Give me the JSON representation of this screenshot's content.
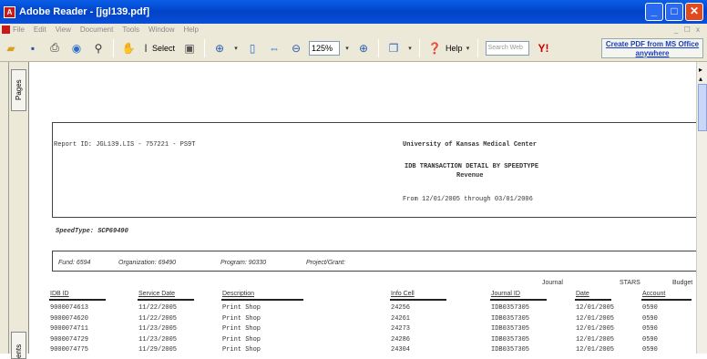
{
  "window": {
    "title": "Adobe Reader - [jgl139.pdf]",
    "minimize": "_",
    "maximize": "□",
    "close": "✕"
  },
  "menu": {
    "items": [
      "File",
      "Edit",
      "View",
      "Document",
      "Tools",
      "Window",
      "Help"
    ],
    "right": "_ ☐ x"
  },
  "toolbar": {
    "select_label": "Select",
    "zoom_value": "125%",
    "help_label": "Help",
    "search_placeholder": "Search Web",
    "create_pdf_line1": "Create PDF from MS Office",
    "create_pdf_line2": "anywhere"
  },
  "side_tabs": {
    "pages": "Pages",
    "attachments": "ents"
  },
  "report": {
    "report_id": "Report ID:  JGL139.LIS - 757221 - PS9T",
    "org_name": "University of Kansas Medical Center",
    "report_title": "IDB TRANSACTION DETAIL BY SPEEDTYPE",
    "revenue": "Revenue",
    "date_range": "From 12/01/2005 through 03/01/2006",
    "speedtype": "SpeedType: SCP69490",
    "fund": "Fund: 6594",
    "organization": "Organization: 69490",
    "program": "Program: 90330",
    "project": "Project/Grant:"
  },
  "table": {
    "group_headers": {
      "journal": "Journal",
      "stars": "STARS",
      "budget": "Budget"
    },
    "columns": [
      "IDB ID",
      "Service Date",
      "Description",
      "Info Cell",
      "Journal ID",
      "Date",
      "Account"
    ],
    "rows": [
      [
        "9000074613",
        "11/22/2005",
        "Print Shop",
        "24256",
        "IDB0357305",
        "12/01/2005",
        "0590"
      ],
      [
        "9000074620",
        "11/22/2005",
        "Print Shop",
        "24261",
        "IDB0357305",
        "12/01/2005",
        "0590"
      ],
      [
        "9000074711",
        "11/23/2005",
        "Print Shop",
        "24273",
        "IDB0357305",
        "12/01/2005",
        "0590"
      ],
      [
        "9000074729",
        "11/23/2005",
        "Print Shop",
        "24286",
        "IDB0357305",
        "12/01/2005",
        "0590"
      ],
      [
        "9000074775",
        "11/29/2005",
        "Print Shop",
        "24304",
        "IDB0357305",
        "12/01/2005",
        "0590"
      ]
    ]
  },
  "colors": {
    "titlebar": "#0143c8",
    "chrome": "#ece9d8",
    "close_button": "#e04a20"
  }
}
